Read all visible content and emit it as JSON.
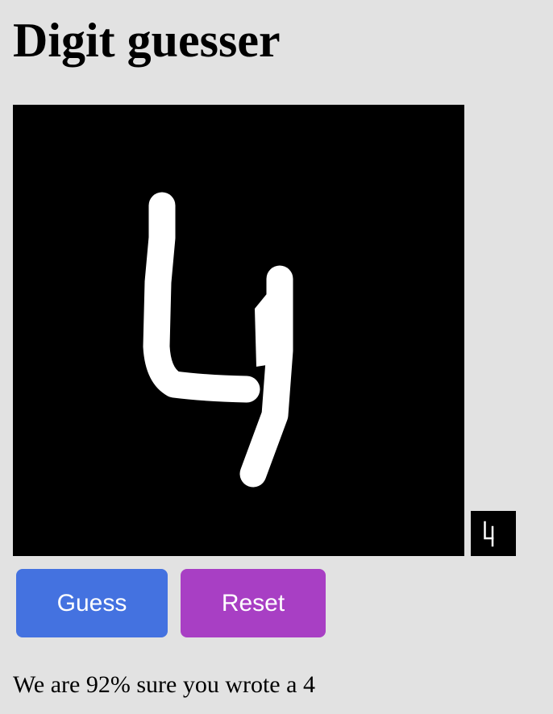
{
  "page": {
    "title": "Digit guesser"
  },
  "drawing": {
    "stroke_color": "#ffffff",
    "background_color": "#000000"
  },
  "buttons": {
    "guess_label": "Guess",
    "guess_color": "#4472e0",
    "reset_label": "Reset",
    "reset_color": "#a83fc4"
  },
  "result": {
    "text": "We are 92% sure you wrote a 4"
  }
}
